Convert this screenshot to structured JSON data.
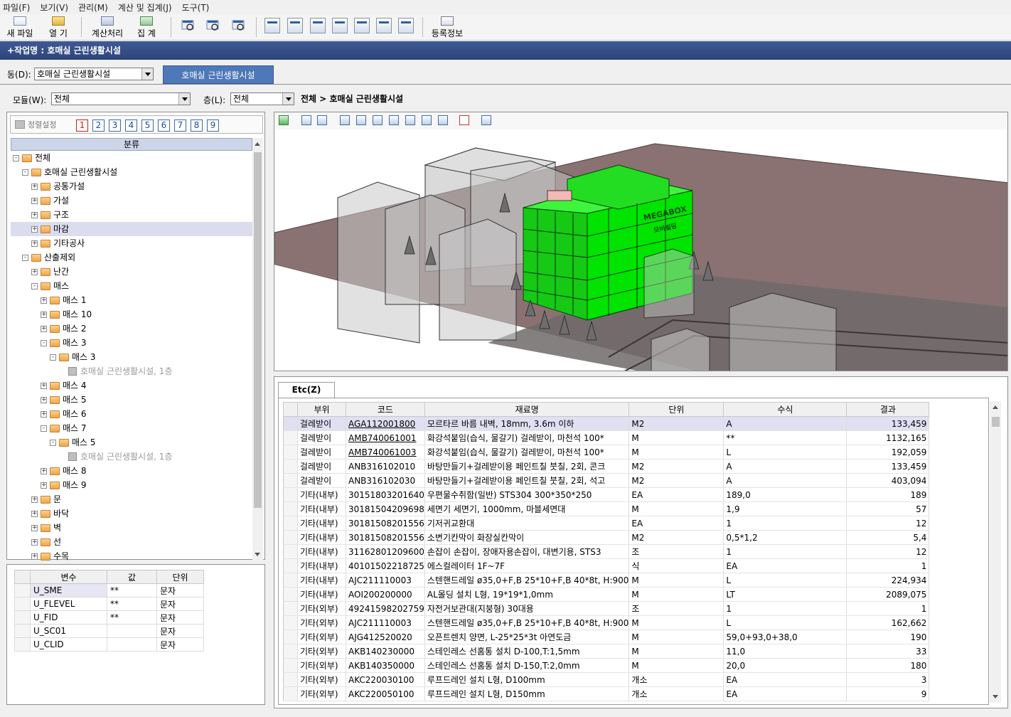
{
  "menu": [
    "파일(F)",
    "보기(V)",
    "관리(M)",
    "계산 및 집계(J)",
    "도구(T)"
  ],
  "toolbar": {
    "new_file": "새 파일",
    "open": "열  기",
    "calc": "계산처리",
    "sum": "집  계",
    "reg": "등록정보"
  },
  "work_title": "+작업명 : 호매실 근린생활시설",
  "dong": {
    "label": "동(D):",
    "value": "호매실 근린생활시설"
  },
  "active_tab": "호매실 근린생활시설",
  "module": {
    "label": "모듈(W):",
    "value": "전체"
  },
  "floor": {
    "label": "층(L):",
    "value": "전체"
  },
  "breadcrumb": "전체 > 호매실 근린생활시설",
  "sort": {
    "label": "정렬설정",
    "buttons": [
      "1",
      "2",
      "3",
      "4",
      "5",
      "6",
      "7",
      "8",
      "9"
    ]
  },
  "tree_header": "분류",
  "tree": [
    {
      "label": "전체",
      "level": 0,
      "exp": "-",
      "type": "folder"
    },
    {
      "label": "호매실 근린생활시설",
      "level": 1,
      "exp": "-",
      "type": "folder"
    },
    {
      "label": "공통가설",
      "level": 2,
      "exp": "+",
      "type": "folder"
    },
    {
      "label": "가설",
      "level": 2,
      "exp": "+",
      "type": "folder"
    },
    {
      "label": "구조",
      "level": 2,
      "exp": "+",
      "type": "folder"
    },
    {
      "label": "마감",
      "level": 2,
      "exp": "+",
      "type": "folder",
      "selected": true
    },
    {
      "label": "기타공사",
      "level": 2,
      "exp": "+",
      "type": "folder"
    },
    {
      "label": "산출제외",
      "level": 1,
      "exp": "-",
      "type": "folder"
    },
    {
      "label": "난간",
      "level": 2,
      "exp": "+",
      "type": "folder"
    },
    {
      "label": "매스",
      "level": 2,
      "exp": "-",
      "type": "folder"
    },
    {
      "label": "매스 1",
      "level": 3,
      "exp": "+",
      "type": "folder"
    },
    {
      "label": "매스 10",
      "level": 3,
      "exp": "+",
      "type": "folder"
    },
    {
      "label": "매스 2",
      "level": 3,
      "exp": "+",
      "type": "folder"
    },
    {
      "label": "매스 3",
      "level": 3,
      "exp": "-",
      "type": "folder"
    },
    {
      "label": "매스 3",
      "level": 4,
      "exp": "-",
      "type": "folder"
    },
    {
      "label": "호매실 근린생활시설, 1층",
      "level": 5,
      "exp": "",
      "type": "leaf"
    },
    {
      "label": "매스 4",
      "level": 3,
      "exp": "+",
      "type": "folder"
    },
    {
      "label": "매스 5",
      "level": 3,
      "exp": "+",
      "type": "folder"
    },
    {
      "label": "매스 6",
      "level": 3,
      "exp": "+",
      "type": "folder"
    },
    {
      "label": "매스 7",
      "level": 3,
      "exp": "-",
      "type": "folder"
    },
    {
      "label": "매스 5",
      "level": 4,
      "exp": "-",
      "type": "folder"
    },
    {
      "label": "호매실 근린생활시설, 1층",
      "level": 5,
      "exp": "",
      "type": "leaf"
    },
    {
      "label": "매스 8",
      "level": 3,
      "exp": "+",
      "type": "folder"
    },
    {
      "label": "매스 9",
      "level": 3,
      "exp": "+",
      "type": "folder"
    },
    {
      "label": "문",
      "level": 2,
      "exp": "+",
      "type": "folder"
    },
    {
      "label": "바닥",
      "level": 2,
      "exp": "+",
      "type": "folder"
    },
    {
      "label": "벽",
      "level": 2,
      "exp": "+",
      "type": "folder"
    },
    {
      "label": "선",
      "level": 2,
      "exp": "+",
      "type": "folder"
    },
    {
      "label": "수목",
      "level": 2,
      "exp": "+",
      "type": "folder"
    }
  ],
  "variables": {
    "headers": [
      "변수",
      "값",
      "단위"
    ],
    "rows": [
      [
        "U_SME",
        "**",
        "문자"
      ],
      [
        "U_FLEVEL",
        "**",
        "문자"
      ],
      [
        "U_FID",
        "**",
        "문자"
      ],
      [
        "U_SC01",
        "",
        "문자"
      ],
      [
        "U_CLID",
        "",
        "문자"
      ]
    ]
  },
  "scene_text": {
    "sign1": "MEGABOX",
    "sign2": "모비빌딩"
  },
  "colors": {
    "accent": "#4e79b8",
    "title_bar": "#2c447a",
    "building": "#00e400",
    "ground": "#8a7272"
  },
  "etc_tab": "Etc(Z)",
  "data_table": {
    "headers": [
      "부위",
      "코드",
      "재료명",
      "단위",
      "수식",
      "결과"
    ],
    "rows": [
      [
        "걸레받이",
        "AGA112001800",
        "모르타르 바름 내벽, 18mm, 3.6m 이하",
        "M2",
        "A",
        "133,459"
      ],
      [
        "걸레받이",
        "AMB740061001",
        "화강석붙임(습식, 물갈기) 걸레받이, 마천석 100*",
        "M",
        "**",
        "1132,165"
      ],
      [
        "걸레받이",
        "AMB740061003",
        "화강석붙임(습식, 물갈기) 걸레받이, 마천석 100*",
        "M",
        "L",
        "192,059"
      ],
      [
        "걸레받이",
        "ANB316102010",
        "바탕만들기+걸레받이용 페인트칠  붓칠, 2회, 콘크",
        "M2",
        "A",
        "133,459"
      ],
      [
        "걸레받이",
        "ANB316102030",
        "바탕만들기+걸레받이용 페인트칠  붓칠, 2회, 석고",
        "M2",
        "A",
        "403,094"
      ],
      [
        "기타(내부)",
        "30151803201640",
        "우편물수취함(일반)  STS304 300*350*250",
        "EA",
        "189,0",
        "189"
      ],
      [
        "기타(내부)",
        "30181504209698",
        "세면기  세면기, 1000mm, 마블세면대",
        "M",
        "1,9",
        "57"
      ],
      [
        "기타(내부)",
        "30181508201556",
        "기저귀교환대",
        "EA",
        "1",
        "12"
      ],
      [
        "기타(내부)",
        "30181508201556",
        "소변기칸막이  화장실칸막이",
        "M2",
        "0,5*1,2",
        "5,4"
      ],
      [
        "기타(내부)",
        "31162801209600",
        "손잡이  손잡이, 장애자용손잡이, 대변기용, STS3",
        "조",
        "1",
        "12"
      ],
      [
        "기타(내부)",
        "40101502218725",
        "에스컬레이터  1F~7F",
        "식",
        "EA",
        "1"
      ],
      [
        "기타(내부)",
        "AJC211110003",
        "스텐핸드레일  ø35,0+F,B 25*10+F,B 40*8t, H:900",
        "M",
        "L",
        "224,934"
      ],
      [
        "기타(내부)",
        "AOI200200000",
        "AL몰딩 설치  L형, 19*19*1,0mm",
        "M",
        "LT",
        "2089,075"
      ],
      [
        "기타(외부)",
        "49241598202759",
        "자전거보관대(지붕형)  30대용",
        "조",
        "1",
        "1"
      ],
      [
        "기타(외부)",
        "AJC211110003",
        "스텐핸드레일  ø35,0+F,B 25*10+F,B 40*8t, H:900",
        "M",
        "L",
        "162,662"
      ],
      [
        "기타(외부)",
        "AJG412520020",
        "오픈트렌치  양면, L-25*25*3t 아연도금",
        "M",
        "59,0+93,0+38,0",
        "190"
      ],
      [
        "기타(외부)",
        "AKB140230000",
        "스테인레스 선홈통 설치  D-100,T:1,5mm",
        "M",
        "11,0",
        "33"
      ],
      [
        "기타(외부)",
        "AKB140350000",
        "스테인레스 선홈통 설치  D-150,T:2,0mm",
        "M",
        "20,0",
        "180"
      ],
      [
        "기타(외부)",
        "AKC220030100",
        "루프드레인 설치  L형, D100mm",
        "개소",
        "EA",
        "3"
      ],
      [
        "기타(외부)",
        "AKC220050100",
        "루프드레인 설치  L형, D150mm",
        "개소",
        "EA",
        "9"
      ]
    ]
  }
}
